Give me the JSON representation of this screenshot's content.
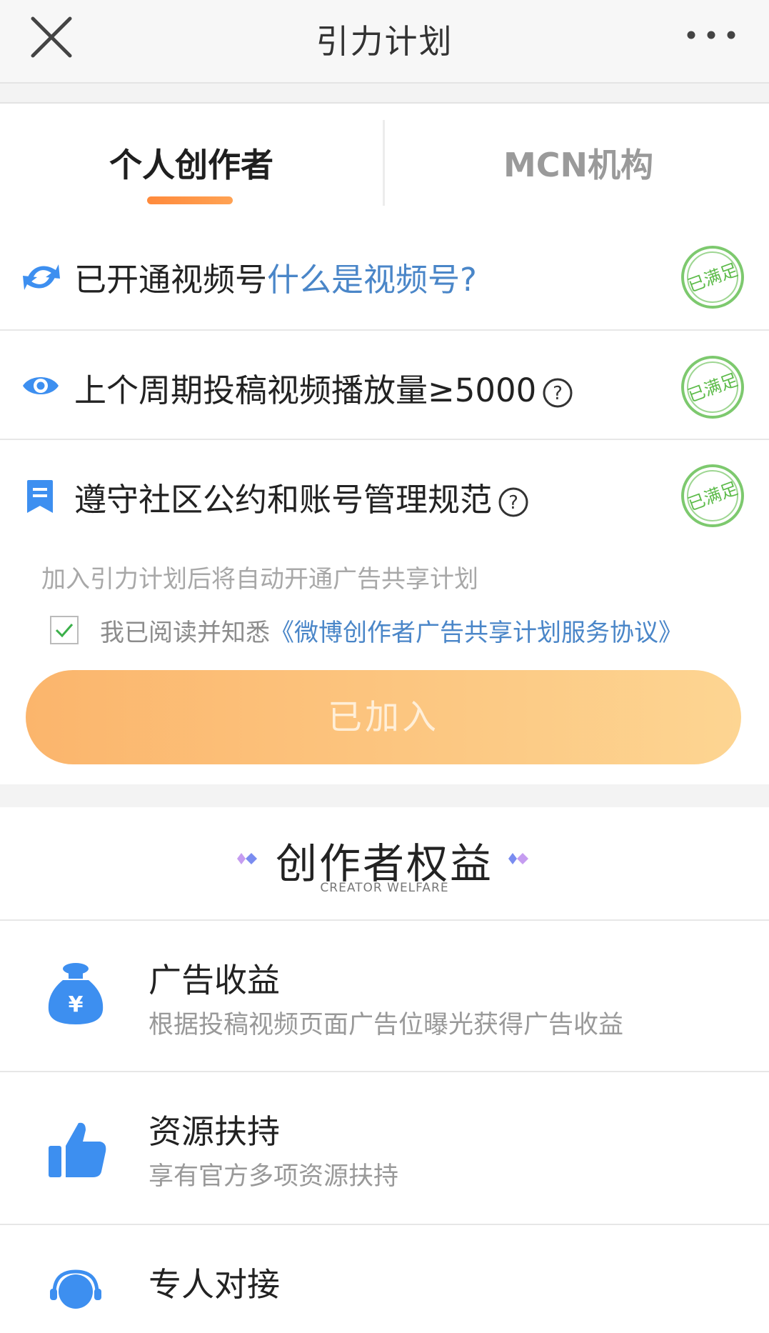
{
  "header": {
    "title": "引力计划"
  },
  "tabs": [
    {
      "label": "个人创作者"
    },
    {
      "label": "MCN机构"
    }
  ],
  "requirements": [
    {
      "text": "已开通视频号",
      "link": "什么是视频号?",
      "status": "已满足"
    },
    {
      "text": "上个周期投稿视频播放量≥5000",
      "status": "已满足"
    },
    {
      "text": "遵守社区公约和账号管理规范",
      "status": "已满足"
    }
  ],
  "note": "加入引力计划后将自动开通广告共享计划",
  "agreement": {
    "prefix": "我已阅读并知悉",
    "link": "《微博创作者广告共享计划服务协议》",
    "checked": true
  },
  "join_button": {
    "label": "已加入"
  },
  "benefits": {
    "title": "创作者权益",
    "subtitle": "CREATOR WELFARE",
    "items": [
      {
        "title": "广告收益",
        "desc": "根据投稿视频页面广告位曝光获得广告收益",
        "icon": "money-bag-icon"
      },
      {
        "title": "资源扶持",
        "desc": "享有官方多项资源扶持",
        "icon": "thumbs-up-icon"
      },
      {
        "title": "专人对接",
        "desc": "",
        "icon": "support-agent-icon"
      }
    ]
  },
  "colors": {
    "accent": "#ff8a3c",
    "link": "#4a86c8",
    "stamp": "#5dbb4a",
    "icon_blue": "#3d8ff0"
  }
}
